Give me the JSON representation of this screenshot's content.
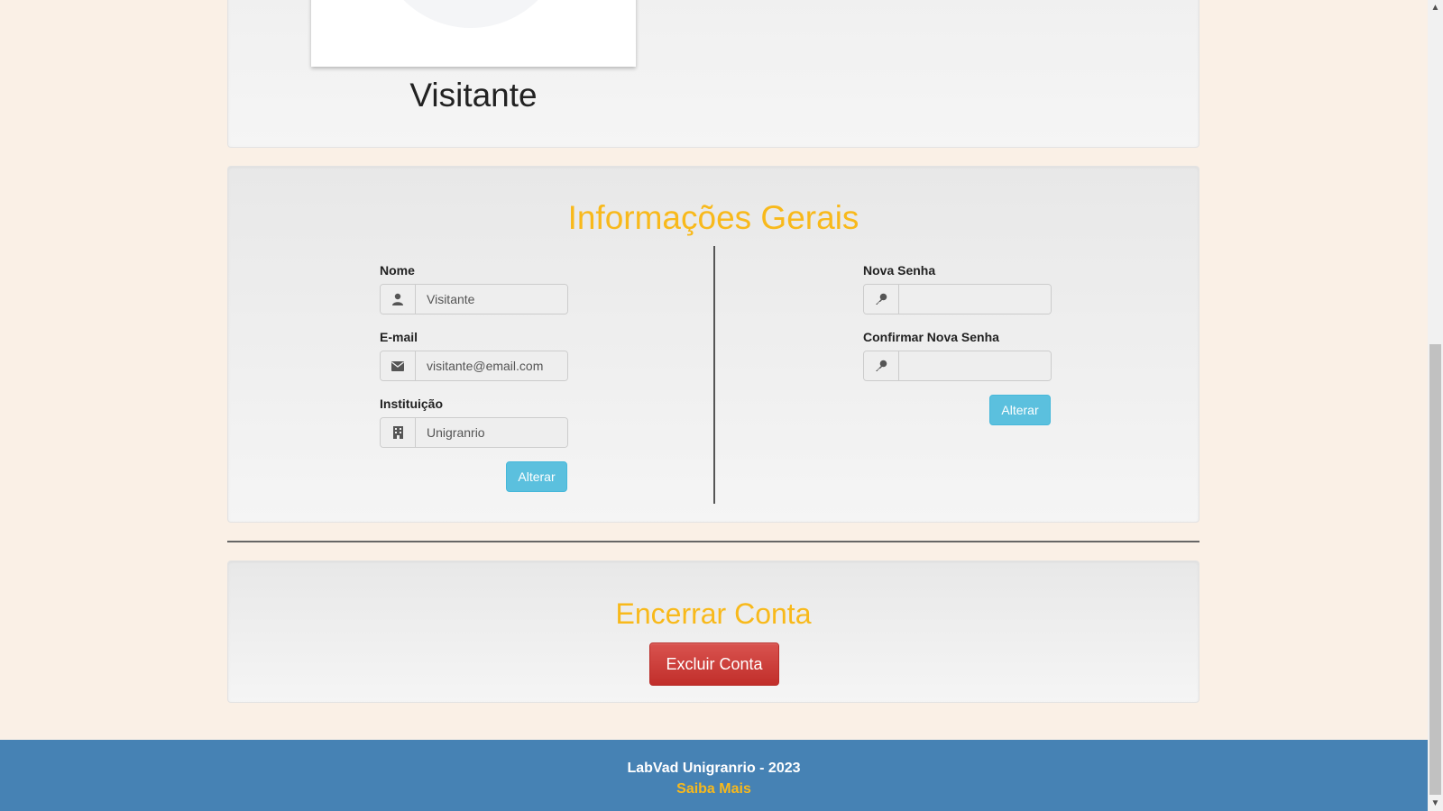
{
  "profile": {
    "name": "Visitante"
  },
  "general_info": {
    "title": "Informações Gerais",
    "name_label": "Nome",
    "name_value": "Visitante",
    "email_label": "E-mail",
    "email_value": "visitante@email.com",
    "institution_label": "Instituição",
    "institution_value": "Unigranrio",
    "update_button": "Alterar",
    "new_password_label": "Nova Senha",
    "new_password_value": "",
    "confirm_password_label": "Confirmar Nova Senha",
    "confirm_password_value": "",
    "password_update_button": "Alterar"
  },
  "close_account": {
    "title": "Encerrar Conta",
    "delete_button": "Excluir Conta"
  },
  "footer": {
    "text": "LabVad Unigranrio - 2023",
    "link": "Saiba Mais"
  },
  "icons": {
    "user": "user-icon",
    "envelope": "envelope-icon",
    "building": "building-icon",
    "key": "key-icon"
  },
  "colors": {
    "page_bg": "#faf0e6",
    "accent": "#f8b91b",
    "info_button": "#5bc0de",
    "danger_button": "#d9534f",
    "footer_bg": "#4682b4"
  }
}
